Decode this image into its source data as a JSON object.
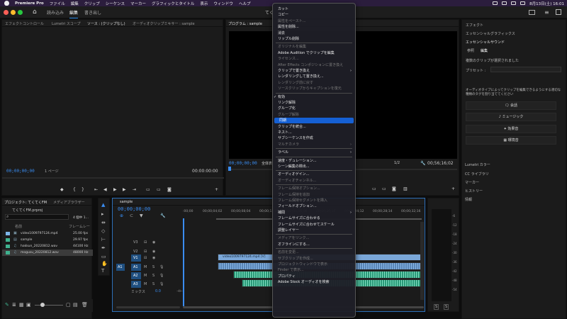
{
  "menubar": {
    "app": "Premiere Pro",
    "items": [
      "ファイル",
      "編集",
      "クリップ",
      "シーケンス",
      "マーカー",
      "グラフィックとタイトル",
      "表示",
      "ウィンドウ",
      "ヘルプ"
    ],
    "clock": "8月13日(土) 16:01"
  },
  "header": {
    "tabs": [
      "読み込み",
      "編集",
      "書き出し"
    ],
    "title": "てく"
  },
  "source_panel": {
    "tabs": [
      "エフェクトコントロール",
      "Lumetri スコープ",
      "ソース : (クリップなし)",
      "オーディオクリップミキサー : sample"
    ],
    "timecode_left": "00;00;00;00",
    "page_select": "1 ページ",
    "timecode_right": "00:00:00:00"
  },
  "program_panel": {
    "tab": "プログラム : sample",
    "timecode": "00;00;00;00",
    "fit": "全体表",
    "res": "1/2",
    "duration": "00;56;16;02"
  },
  "project_panel": {
    "tabs": [
      "プロジェクト: てくてくFM",
      "メディアブラウザー"
    ],
    "filename": "てくてくFM.prproj",
    "count": "4 個中 1...",
    "col_name": "名前",
    "col_rate": "フレームレー",
    "items": [
      {
        "name": "video1009797124.mp4",
        "rate": "25.00 fps",
        "color": "#7db5e8"
      },
      {
        "name": "sample",
        "rate": "29.97 fps",
        "color": "#3fb28f"
      },
      {
        "name": "hakkun_20220812.wav",
        "rate": "44100 Hz",
        "color": "#3fb28f"
      },
      {
        "name": "mogusu_20220812.wav",
        "rate": "48000 Hz",
        "color": "#3fb28f"
      }
    ]
  },
  "timeline": {
    "tab": "sample",
    "timecode": "00;00;00;00",
    "ruler": [
      ":00;00",
      "00;00;04;02",
      "00;00;08;04",
      "00;00;12;06",
      "00;00;16;08",
      "00;00;20;10",
      "00;00;24;12",
      "00;00;28;14",
      "00;00;32;16",
      "00;00;36;18"
    ],
    "video_tracks": [
      "V3",
      "V2",
      "V1"
    ],
    "audio_tracks": [
      "A1",
      "A2",
      "A3"
    ],
    "mix_label": "ミックス",
    "mix_value": "0.0",
    "src_v": "V1",
    "src_a": "A1",
    "clip_label": "video1009797124.mp4 [V]"
  },
  "meter": {
    "labels": [
      "-6",
      "-12",
      "-18",
      "-24",
      "-30",
      "-36",
      "-42",
      "-48",
      "-54"
    ],
    "s_label": "S",
    "s_label2": "S"
  },
  "context_menu": {
    "highlighted": "同期",
    "rows": [
      {
        "label": "カット",
        "state": "on"
      },
      {
        "label": "コピー",
        "state": "on"
      },
      {
        "label": "属性をペースト...",
        "state": "off"
      },
      {
        "label": "属性を削除...",
        "state": "on"
      },
      {
        "label": "消去",
        "state": "on"
      },
      {
        "label": "リップル削除",
        "state": "on"
      },
      {
        "sep": true
      },
      {
        "label": "オリジナルを編集",
        "state": "off"
      },
      {
        "label": "Adobe Audition でクリップを編集",
        "state": "on"
      },
      {
        "label": "ライセンス...",
        "state": "off"
      },
      {
        "label": "After Effects コンポジションに置き換え",
        "state": "off"
      },
      {
        "label": "クリップで置き換え",
        "state": "on",
        "sub": true
      },
      {
        "label": "レンダリングして置き換え...",
        "state": "on"
      },
      {
        "label": "レンダリング前に戻す",
        "state": "off"
      },
      {
        "label": "ソースクリップからキャプションを復元",
        "state": "off"
      },
      {
        "sep": true
      },
      {
        "label": "有効",
        "state": "on",
        "check": true
      },
      {
        "label": "リンク解除",
        "state": "on"
      },
      {
        "label": "グループ化",
        "state": "on"
      },
      {
        "label": "グループ解除",
        "state": "off"
      },
      {
        "label": "同期",
        "state": "hl"
      },
      {
        "label": "クリップを統合...",
        "state": "on"
      },
      {
        "label": "ネスト...",
        "state": "on"
      },
      {
        "label": "サブシーケンスを作成",
        "state": "on"
      },
      {
        "label": "マルチカメラ",
        "state": "off",
        "sub": true
      },
      {
        "sep": true
      },
      {
        "label": "ラベル",
        "state": "on",
        "sub": true
      },
      {
        "sep": true
      },
      {
        "label": "速度・デュレーション...",
        "state": "on"
      },
      {
        "label": "シーン編集の検出...",
        "state": "on"
      },
      {
        "sep": true
      },
      {
        "label": "オーディオゲイン...",
        "state": "on"
      },
      {
        "label": "オーディオチャンネル...",
        "state": "off"
      },
      {
        "sep": true
      },
      {
        "label": "フレーム保持オプション...",
        "state": "off"
      },
      {
        "label": "フレーム保持を追加",
        "state": "off"
      },
      {
        "label": "フレーム保持セグメントを挿入",
        "state": "off"
      },
      {
        "label": "フィールドオプション...",
        "state": "on"
      },
      {
        "label": "補間",
        "state": "on",
        "sub": true
      },
      {
        "label": "フレームサイズに合わせる",
        "state": "on"
      },
      {
        "label": "フレームサイズに合わせてスケール",
        "state": "on"
      },
      {
        "label": "調整レイヤー",
        "state": "on"
      },
      {
        "sep": true
      },
      {
        "label": "メディアをリンク...",
        "state": "off"
      },
      {
        "label": "オフラインにする...",
        "state": "on"
      },
      {
        "sep": true
      },
      {
        "label": "名前を変更...",
        "state": "off"
      },
      {
        "label": "サブクリップを作成...",
        "state": "off"
      },
      {
        "label": "プロジェクトウィンドウで表示",
        "state": "off"
      },
      {
        "label": "Finder で表示...",
        "state": "off"
      },
      {
        "label": "プロパティ",
        "state": "on"
      },
      {
        "label": "Adobe Stock オーディオを検索",
        "state": "on"
      }
    ]
  },
  "right_panel": {
    "items": [
      "エフェクト",
      "エッセンシャルグラフィックス",
      "エッセンシャルサウンド"
    ],
    "tabs": [
      "参照",
      "編集"
    ],
    "note": "複数のクリップが選択されました",
    "preset": "プリセット :",
    "desc": "オーディオタイプによってクリップを編集できるようにする適切な種類のタグを割り当ててください",
    "buttons": [
      "会話",
      "ミュージック",
      "効果音",
      "環境音"
    ],
    "lower": [
      "Lumetri カラー",
      "CC ライブラリ",
      "マーカー",
      "ヒストリー",
      "情報"
    ]
  }
}
